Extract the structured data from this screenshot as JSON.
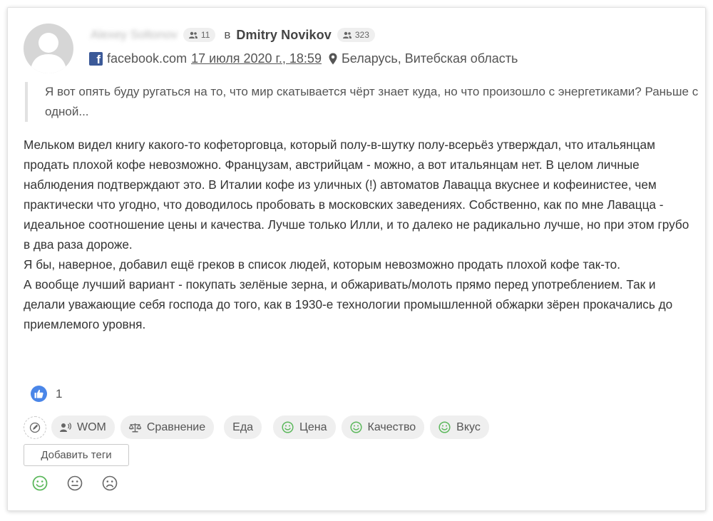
{
  "author": {
    "name": "Alexey Soltonov",
    "followers": "11"
  },
  "in_word": "в",
  "target": {
    "name": "Dmitry Novikov",
    "followers": "323"
  },
  "source": {
    "site": "facebook.com",
    "date": "17 июля 2020 г., 18:59",
    "location": "Беларусь, Витебская область"
  },
  "quote": "Я вот опять буду ругаться на то, что мир скатывается чёрт знает куда, но что произошло с энергетиками? Раньше с одной...",
  "body": "Мельком видел книгу какого-то кофеторговца, который полу-в-шутку полу-всерьёз утверждал, что итальянцам продать плохой кофе невозможно. Французам, австрийцам - можно, а вот итальянцам нет. В целом личные наблюдения подтверждают это. В Италии кофе из уличных (!) автоматов Лавацца вкуснее и кофеинистее, чем практически что угодно, что доводилось пробовать в московских заведениях. Собственно, как по мне Лавацца - идеальное соотношение цены и качества. Лучше только Илли, и то далеко не радикально лучше, но при этом грубо в два раза дороже.\nЯ бы, наверное, добавил ещё греков в список людей, которым невозможно продать плохой кофе так-то.\nА вообще лучший вариант - покупать зелёные зерна, и обжаривать/молоть прямо перед употреблением. Так и делали уважающие себя господа до того, как в 1930-е технологии промышленной обжарки зёрен прокачались до приемлемого уровня.",
  "likes": "1",
  "tags": [
    {
      "label": "WOM",
      "icon": "megaphone-icon"
    },
    {
      "label": "Сравнение",
      "icon": "scales-icon"
    },
    {
      "label": "Еда",
      "icon": ""
    },
    {
      "label": "Цена",
      "icon": "smile-icon"
    },
    {
      "label": "Качество",
      "icon": "smile-icon"
    },
    {
      "label": "Вкус",
      "icon": "smile-icon"
    }
  ],
  "add_tags_label": "Добавить теги",
  "colors": {
    "positive": "#5cb85c",
    "like": "#4a86e8",
    "facebook": "#3b5998"
  }
}
